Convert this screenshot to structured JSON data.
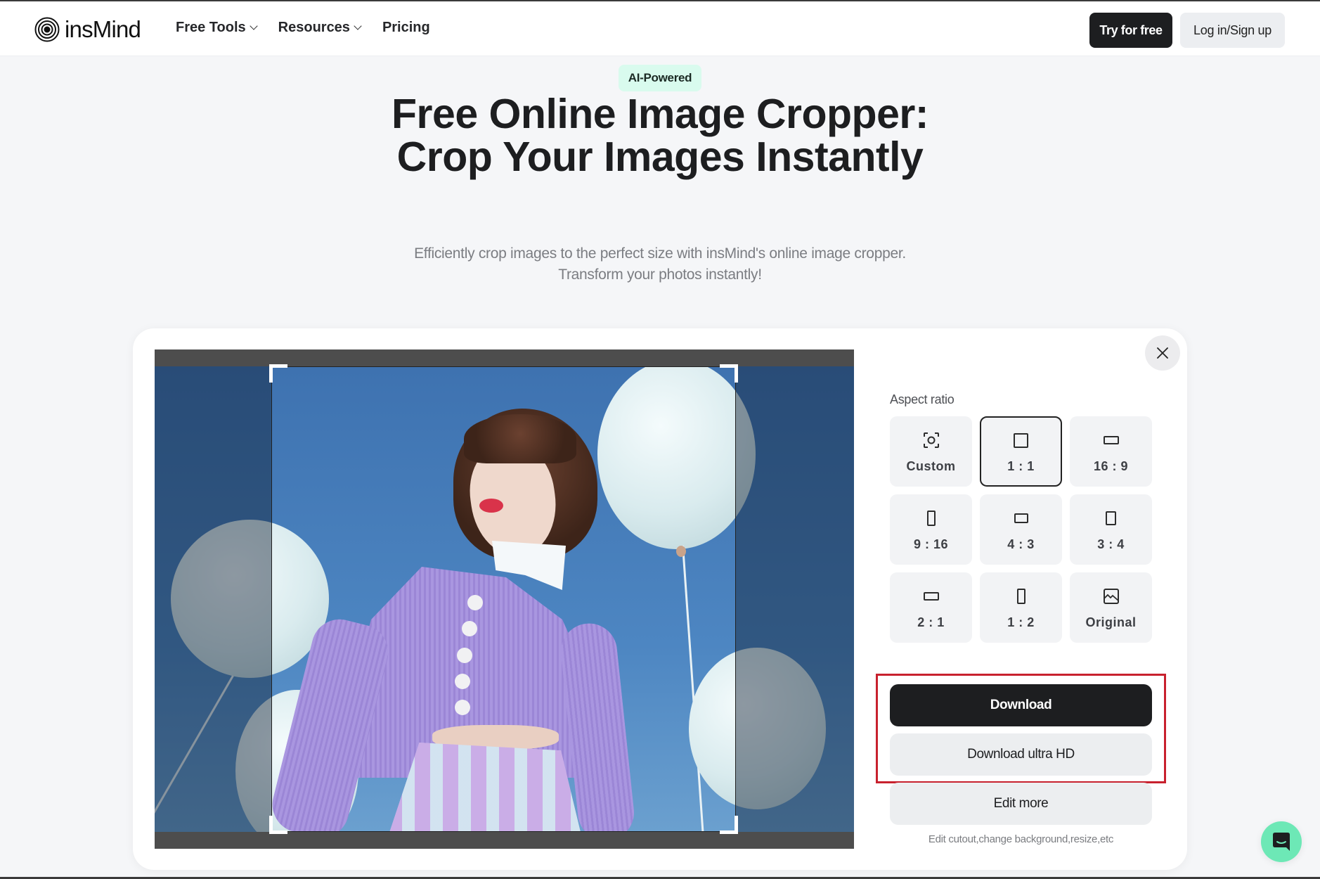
{
  "header": {
    "brand": "insMind",
    "nav": [
      {
        "label": "Free Tools",
        "has_dropdown": true
      },
      {
        "label": "Resources",
        "has_dropdown": true
      },
      {
        "label": "Pricing",
        "has_dropdown": false
      }
    ],
    "try_free_label": "Try for free",
    "login_label": "Log in/Sign up"
  },
  "hero": {
    "badge": "AI-Powered",
    "title": "Free Online Image Cropper: Crop Your Images Instantly",
    "subtitle": "Efficiently crop images to the perfect size with insMind's online image cropper. Transform your photos instantly!"
  },
  "editor": {
    "image_description": "Woman in lavender knit cardigan with white collar among white balloons against blue sky",
    "close_icon": "close-icon",
    "aspect_ratio_label": "Aspect ratio",
    "selected_ratio": "1 : 1",
    "ratios": [
      {
        "label": "Custom",
        "icon": "custom-crop-icon"
      },
      {
        "label": "1 : 1",
        "icon": "square-icon"
      },
      {
        "label": "16 : 9",
        "icon": "landscape-wide-icon"
      },
      {
        "label": "9 : 16",
        "icon": "portrait-tall-icon"
      },
      {
        "label": "4 : 3",
        "icon": "landscape-icon"
      },
      {
        "label": "3 : 4",
        "icon": "portrait-icon"
      },
      {
        "label": "2 : 1",
        "icon": "landscape-2-1-icon"
      },
      {
        "label": "1 : 2",
        "icon": "portrait-1-2-icon"
      },
      {
        "label": "Original",
        "icon": "image-icon"
      }
    ],
    "download_label": "Download",
    "download_hd_label": "Download ultra HD",
    "edit_more_label": "Edit more",
    "edit_hint": "Edit cutout,change background,resize,etc"
  },
  "colors": {
    "primary": "#1d1e20",
    "badge_bg": "#d9fbee",
    "highlight": "#c8212e",
    "chat": "#6de8b6"
  }
}
